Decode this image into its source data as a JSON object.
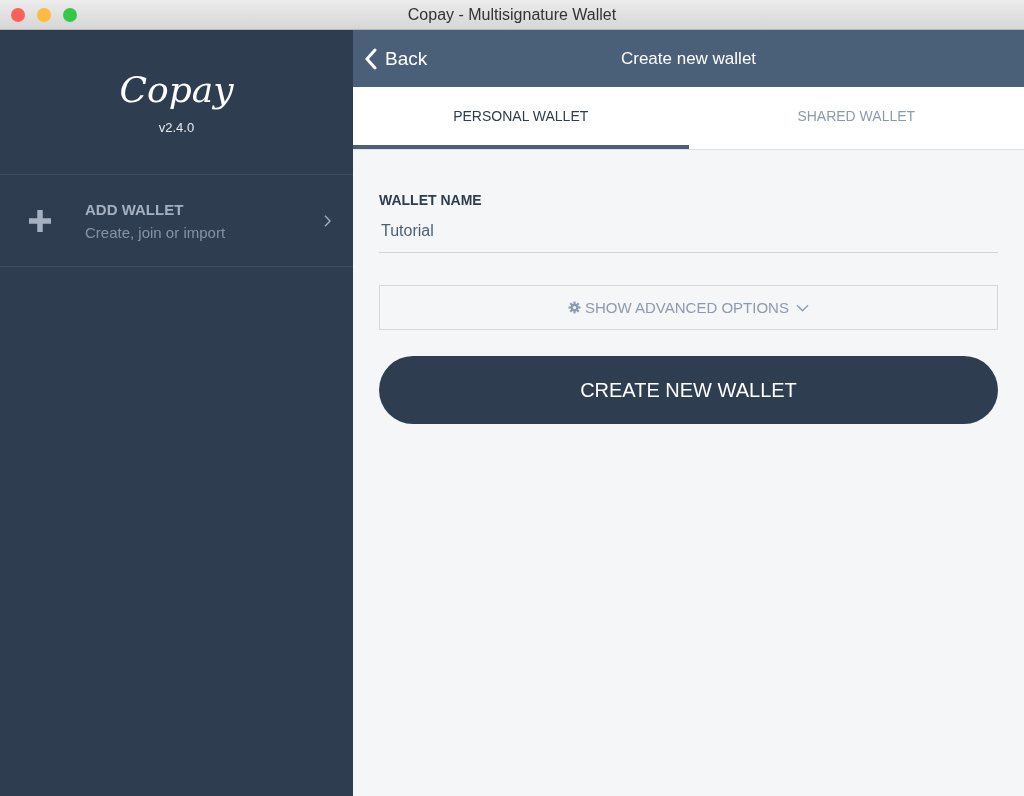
{
  "window": {
    "title": "Copay - Multisignature Wallet"
  },
  "sidebar": {
    "logo": "Copay",
    "version": "v2.4.0",
    "items": [
      {
        "title": "ADD WALLET",
        "subtitle": "Create, join or import"
      }
    ]
  },
  "header": {
    "back": "Back",
    "title": "Create new wallet"
  },
  "tabs": [
    {
      "label": "PERSONAL WALLET",
      "selected": true
    },
    {
      "label": "SHARED WALLET",
      "selected": false
    }
  ],
  "form": {
    "label": "WALLET NAME",
    "value": "Tutorial",
    "advanced": "SHOW ADVANCED OPTIONS",
    "submit": "CREATE NEW WALLET"
  }
}
